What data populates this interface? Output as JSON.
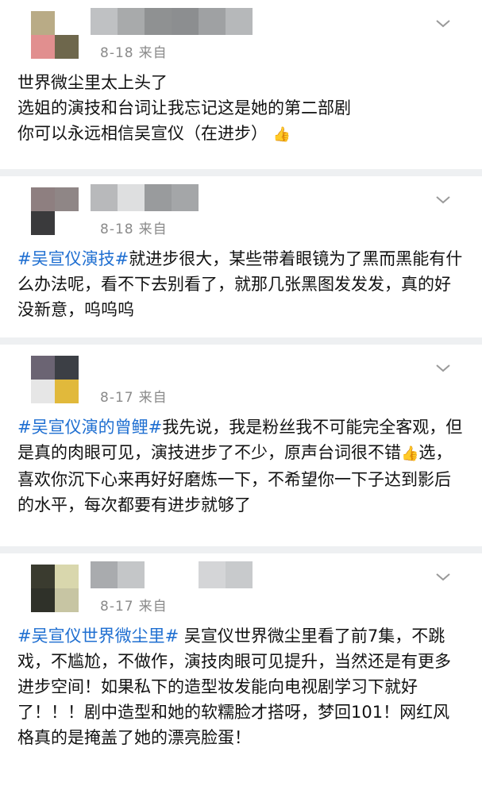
{
  "posts": [
    {
      "date": "8-18",
      "source": "来自",
      "lines": [
        {
          "hashtag": "",
          "text": "世界微尘里太上头了"
        },
        {
          "hashtag": "",
          "text": "选姐的演技和台词让我忘记这是她的第二部剧"
        },
        {
          "hashtag": "",
          "text": "你可以永远相信吴宣仪（在进步）"
        }
      ],
      "emoji": "👍"
    },
    {
      "date": "8-18",
      "source": "来自",
      "hashtag": "#吴宣仪演技#",
      "text": "就进步很大，某些带着眼镜为了黑而黑能有什么办法呢，看不下去别看了，就那几张黑图发发发，真的好没新意，呜呜呜"
    },
    {
      "date": "8-17",
      "source": "来自",
      "hashtag": "#吴宣仪演的曾鲤#",
      "text_a": "我先说，我是粉丝我不可能完全客观，但是真的肉眼可见，演技进步了不少，原声台词很不错",
      "emoji": "👍",
      "text_b": "选，喜欢你沉下心来再好好磨炼一下，不希望你一下子达到影后的水平，每次都要有进步就够了"
    },
    {
      "date": "8-17",
      "source": "来自",
      "hashtag": "#吴宣仪世界微尘里#",
      "text": " 吴宣仪世界微尘里看了前7集，不跳戏，不尴尬，不做作，演技肉眼可见提升，当然还是有更多进步空间！如果私下的造型妆发能向电视剧学习下就好了！！！剧中造型和她的软糯脸才搭呀，梦回101！网红风格真的是掩盖了她的漂亮脸蛋！"
    }
  ],
  "colors": {
    "hashtag": "#1f6fd1",
    "meta": "#8a8a8a",
    "background": "#eef0f2"
  },
  "icons": {
    "menu": "chevron-down-icon"
  }
}
